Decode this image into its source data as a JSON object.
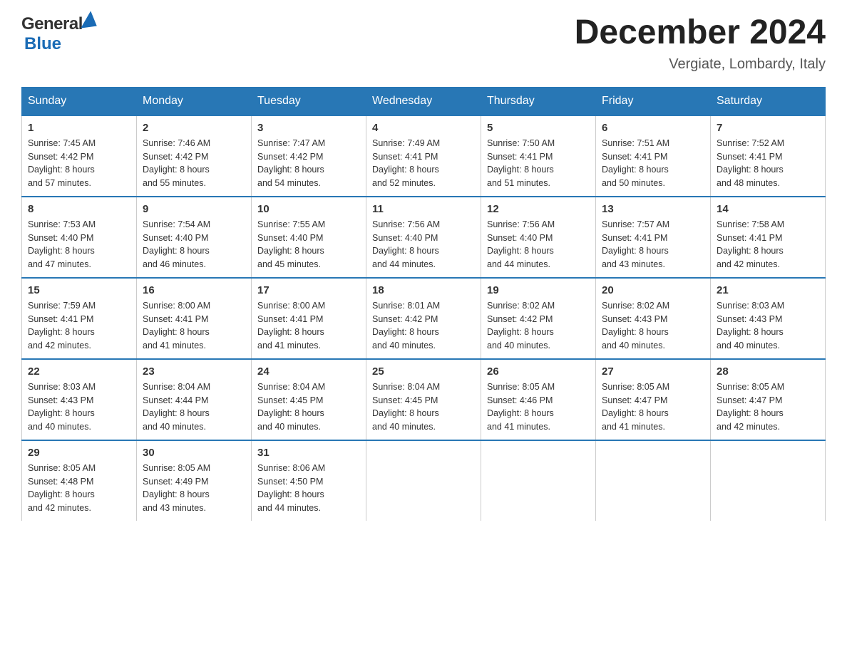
{
  "header": {
    "month_title": "December 2024",
    "location": "Vergiate, Lombardy, Italy",
    "logo_general": "General",
    "logo_blue": "Blue"
  },
  "weekdays": [
    "Sunday",
    "Monday",
    "Tuesday",
    "Wednesday",
    "Thursday",
    "Friday",
    "Saturday"
  ],
  "weeks": [
    [
      {
        "day": "1",
        "sunrise": "7:45 AM",
        "sunset": "4:42 PM",
        "daylight": "8 hours and 57 minutes."
      },
      {
        "day": "2",
        "sunrise": "7:46 AM",
        "sunset": "4:42 PM",
        "daylight": "8 hours and 55 minutes."
      },
      {
        "day": "3",
        "sunrise": "7:47 AM",
        "sunset": "4:42 PM",
        "daylight": "8 hours and 54 minutes."
      },
      {
        "day": "4",
        "sunrise": "7:49 AM",
        "sunset": "4:41 PM",
        "daylight": "8 hours and 52 minutes."
      },
      {
        "day": "5",
        "sunrise": "7:50 AM",
        "sunset": "4:41 PM",
        "daylight": "8 hours and 51 minutes."
      },
      {
        "day": "6",
        "sunrise": "7:51 AM",
        "sunset": "4:41 PM",
        "daylight": "8 hours and 50 minutes."
      },
      {
        "day": "7",
        "sunrise": "7:52 AM",
        "sunset": "4:41 PM",
        "daylight": "8 hours and 48 minutes."
      }
    ],
    [
      {
        "day": "8",
        "sunrise": "7:53 AM",
        "sunset": "4:40 PM",
        "daylight": "8 hours and 47 minutes."
      },
      {
        "day": "9",
        "sunrise": "7:54 AM",
        "sunset": "4:40 PM",
        "daylight": "8 hours and 46 minutes."
      },
      {
        "day": "10",
        "sunrise": "7:55 AM",
        "sunset": "4:40 PM",
        "daylight": "8 hours and 45 minutes."
      },
      {
        "day": "11",
        "sunrise": "7:56 AM",
        "sunset": "4:40 PM",
        "daylight": "8 hours and 44 minutes."
      },
      {
        "day": "12",
        "sunrise": "7:56 AM",
        "sunset": "4:40 PM",
        "daylight": "8 hours and 44 minutes."
      },
      {
        "day": "13",
        "sunrise": "7:57 AM",
        "sunset": "4:41 PM",
        "daylight": "8 hours and 43 minutes."
      },
      {
        "day": "14",
        "sunrise": "7:58 AM",
        "sunset": "4:41 PM",
        "daylight": "8 hours and 42 minutes."
      }
    ],
    [
      {
        "day": "15",
        "sunrise": "7:59 AM",
        "sunset": "4:41 PM",
        "daylight": "8 hours and 42 minutes."
      },
      {
        "day": "16",
        "sunrise": "8:00 AM",
        "sunset": "4:41 PM",
        "daylight": "8 hours and 41 minutes."
      },
      {
        "day": "17",
        "sunrise": "8:00 AM",
        "sunset": "4:41 PM",
        "daylight": "8 hours and 41 minutes."
      },
      {
        "day": "18",
        "sunrise": "8:01 AM",
        "sunset": "4:42 PM",
        "daylight": "8 hours and 40 minutes."
      },
      {
        "day": "19",
        "sunrise": "8:02 AM",
        "sunset": "4:42 PM",
        "daylight": "8 hours and 40 minutes."
      },
      {
        "day": "20",
        "sunrise": "8:02 AM",
        "sunset": "4:43 PM",
        "daylight": "8 hours and 40 minutes."
      },
      {
        "day": "21",
        "sunrise": "8:03 AM",
        "sunset": "4:43 PM",
        "daylight": "8 hours and 40 minutes."
      }
    ],
    [
      {
        "day": "22",
        "sunrise": "8:03 AM",
        "sunset": "4:43 PM",
        "daylight": "8 hours and 40 minutes."
      },
      {
        "day": "23",
        "sunrise": "8:04 AM",
        "sunset": "4:44 PM",
        "daylight": "8 hours and 40 minutes."
      },
      {
        "day": "24",
        "sunrise": "8:04 AM",
        "sunset": "4:45 PM",
        "daylight": "8 hours and 40 minutes."
      },
      {
        "day": "25",
        "sunrise": "8:04 AM",
        "sunset": "4:45 PM",
        "daylight": "8 hours and 40 minutes."
      },
      {
        "day": "26",
        "sunrise": "8:05 AM",
        "sunset": "4:46 PM",
        "daylight": "8 hours and 41 minutes."
      },
      {
        "day": "27",
        "sunrise": "8:05 AM",
        "sunset": "4:47 PM",
        "daylight": "8 hours and 41 minutes."
      },
      {
        "day": "28",
        "sunrise": "8:05 AM",
        "sunset": "4:47 PM",
        "daylight": "8 hours and 42 minutes."
      }
    ],
    [
      {
        "day": "29",
        "sunrise": "8:05 AM",
        "sunset": "4:48 PM",
        "daylight": "8 hours and 42 minutes."
      },
      {
        "day": "30",
        "sunrise": "8:05 AM",
        "sunset": "4:49 PM",
        "daylight": "8 hours and 43 minutes."
      },
      {
        "day": "31",
        "sunrise": "8:06 AM",
        "sunset": "4:50 PM",
        "daylight": "8 hours and 44 minutes."
      },
      null,
      null,
      null,
      null
    ]
  ],
  "labels": {
    "sunrise": "Sunrise:",
    "sunset": "Sunset:",
    "daylight": "Daylight:"
  }
}
